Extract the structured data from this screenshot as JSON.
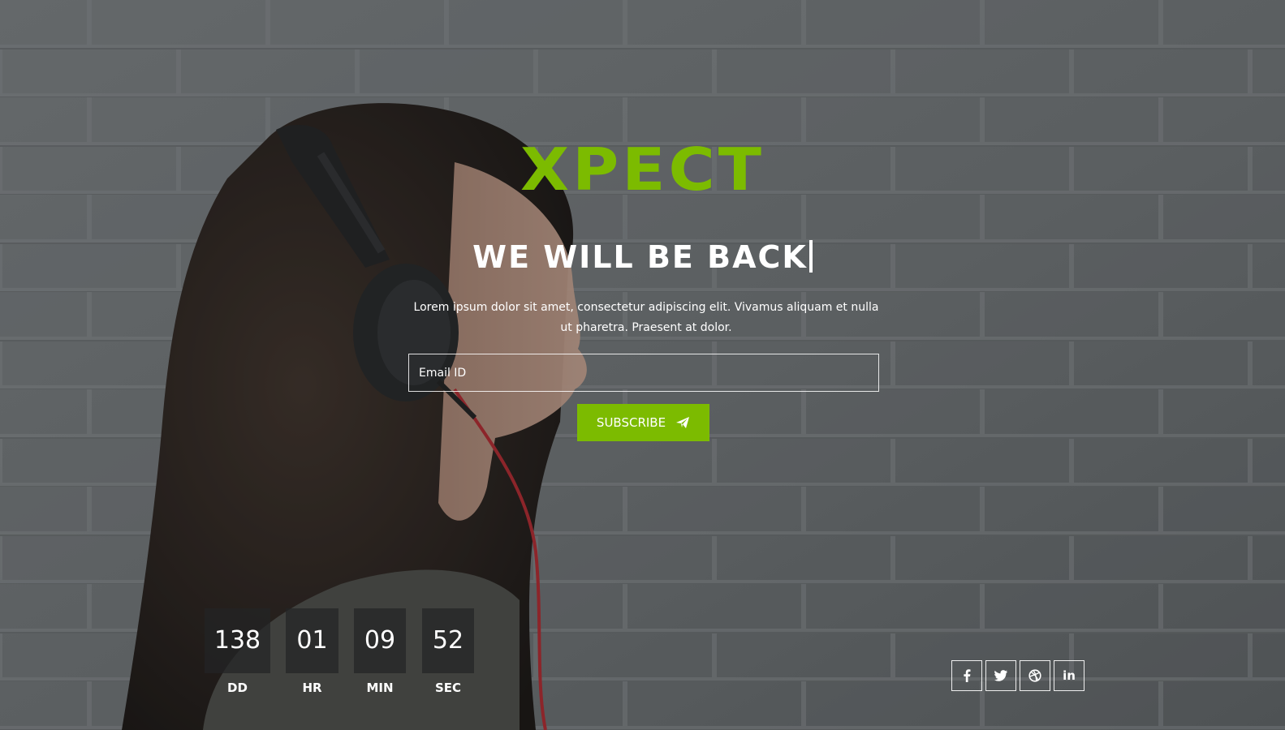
{
  "brand": {
    "logo_text": "XPECT",
    "accent_color": "#7cbb00"
  },
  "hero": {
    "headline": "WE WILL BE BACK",
    "description": "Lorem ipsum dolor sit amet, consectetur adipiscing elit. Vivamus aliquam et nulla ut pharetra. Praesent at dolor."
  },
  "form": {
    "email_placeholder": "Email ID",
    "email_value": "",
    "subscribe_label": "SUBSCRIBE",
    "subscribe_icon": "paper-plane-icon"
  },
  "countdown": {
    "days": {
      "value": "138",
      "label": "DD"
    },
    "hours": {
      "value": "01",
      "label": "HR"
    },
    "minutes": {
      "value": "09",
      "label": "MIN"
    },
    "seconds": {
      "value": "52",
      "label": "SEC"
    }
  },
  "social": [
    {
      "name": "facebook",
      "icon": "facebook-icon"
    },
    {
      "name": "twitter",
      "icon": "twitter-icon"
    },
    {
      "name": "dribbble",
      "icon": "dribbble-icon"
    },
    {
      "name": "linkedin",
      "icon": "linkedin-icon",
      "glyph": "in"
    }
  ]
}
